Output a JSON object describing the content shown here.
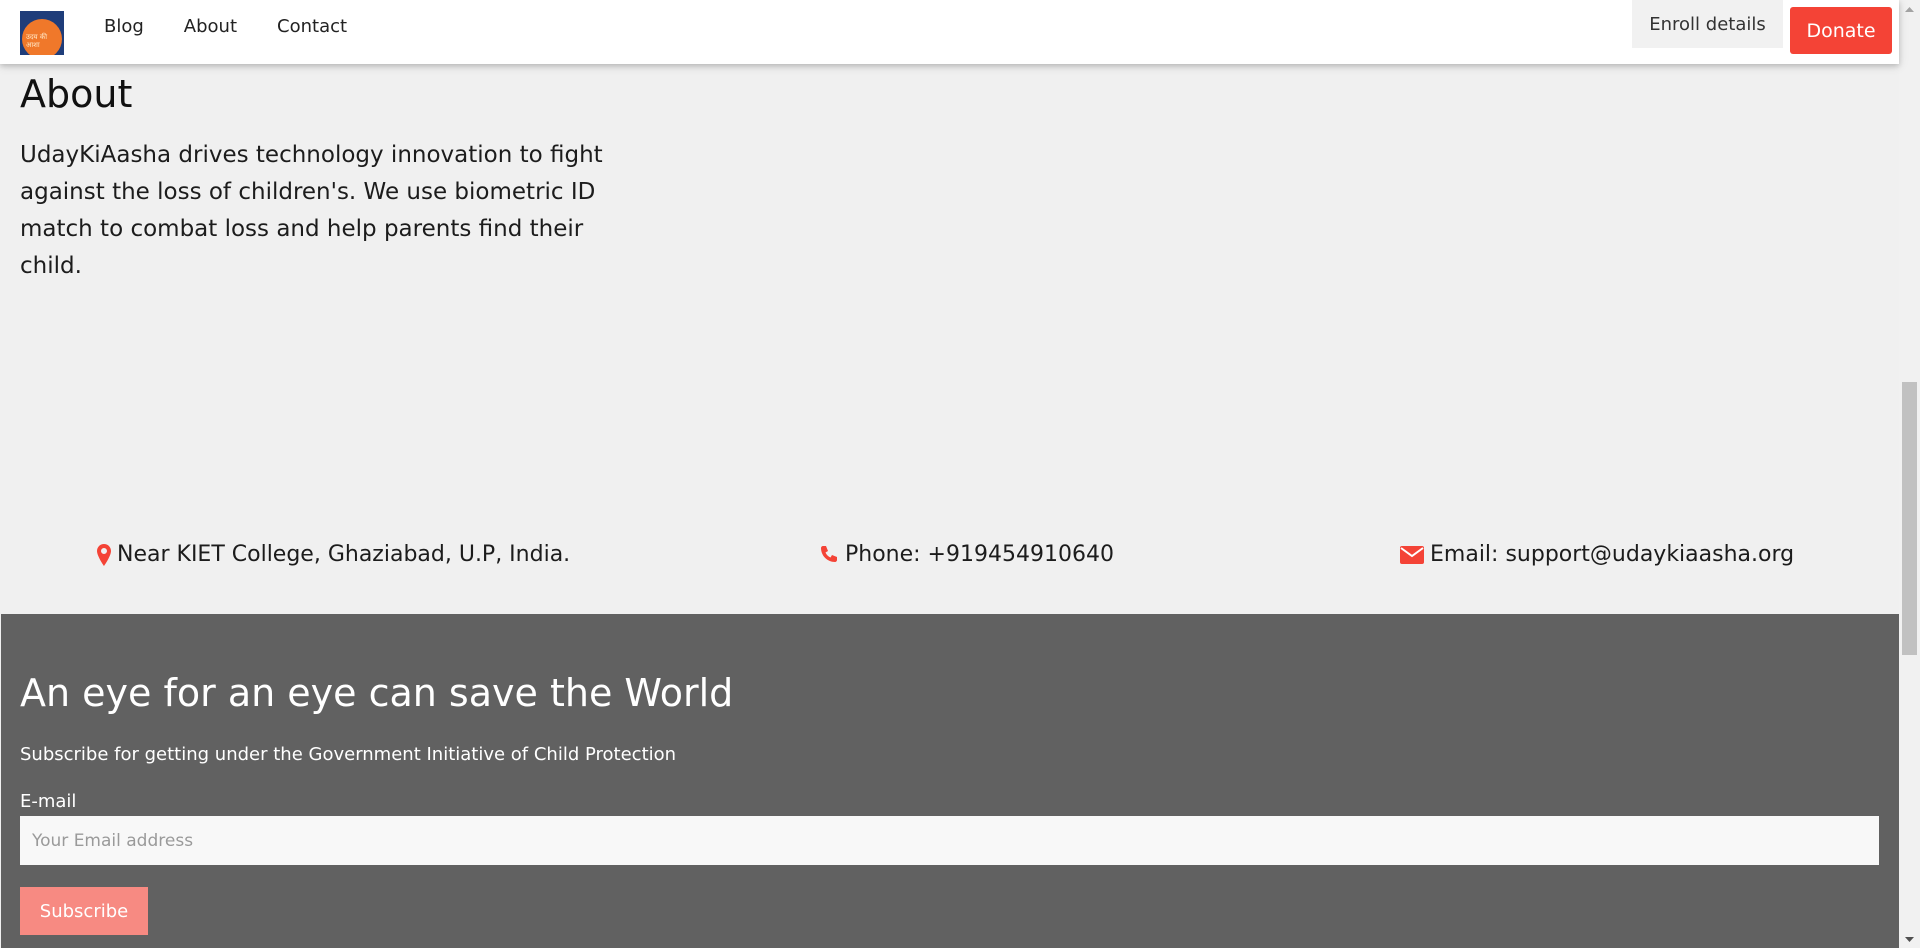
{
  "nav": {
    "logo_text": "उदय की आशा",
    "links": [
      "Blog",
      "About",
      "Contact"
    ],
    "enroll_label": "Enroll details",
    "donate_label": "Donate"
  },
  "about": {
    "title": "About",
    "text": "UdayKiAasha drives technology innovation to fight against the loss of children's. We use biometric ID match to combat loss and help parents find their child."
  },
  "contact": {
    "address": "Near KIET College, Ghaziabad, U.P, India.",
    "phone": "Phone: +919454910640",
    "email": "Email: support@udaykiaasha.org"
  },
  "footer": {
    "title": "An eye for an eye can save the World",
    "subtitle": "Subscribe for getting under the Government Initiative of Child Protection",
    "email_label": "E-mail",
    "email_placeholder": "Your Email address",
    "email_value": "",
    "subscribe_label": "Subscribe"
  },
  "colors": {
    "accent": "#f44336",
    "footer_bg": "#616161",
    "subscribe_bg": "#f78a82",
    "page_bg": "#f0f0f0"
  },
  "icons": {
    "address": "map-marker-icon",
    "phone": "phone-icon",
    "email": "envelope-icon"
  }
}
